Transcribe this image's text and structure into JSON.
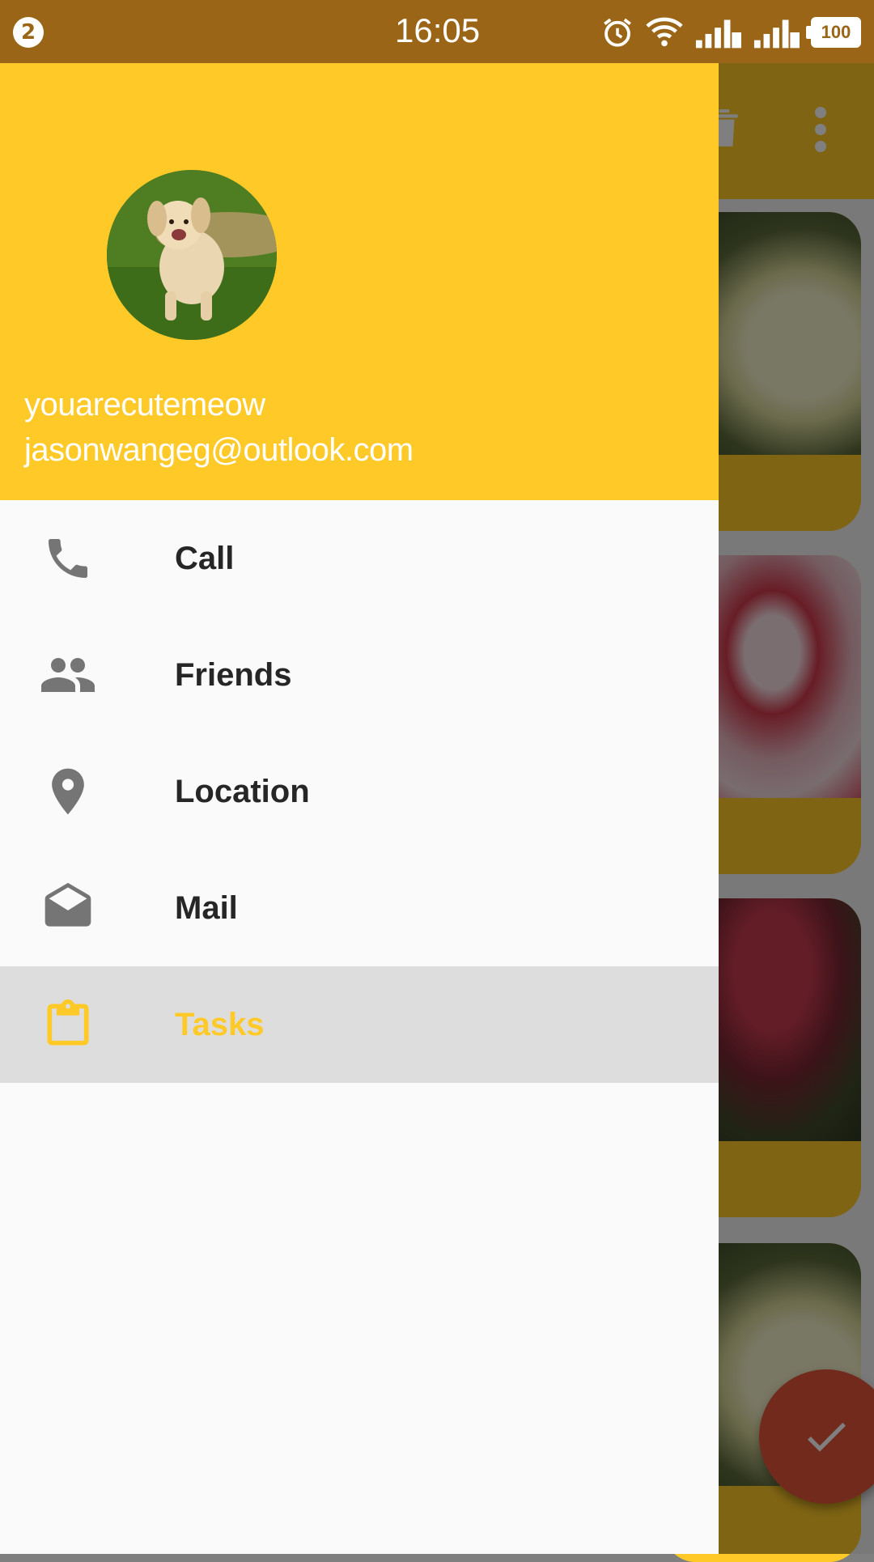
{
  "status_bar": {
    "notification_count": "2",
    "time": "16:05",
    "battery": "100",
    "icons": [
      "alarm-icon",
      "wifi-icon",
      "signal-sim2-icon",
      "signal-sim1-icon",
      "battery-icon"
    ]
  },
  "toolbar": {
    "icons": [
      "delete-icon",
      "more-vert-icon"
    ]
  },
  "drawer": {
    "header": {
      "username": "youarecutemeow",
      "email": "jasonwangeg@outlook.com"
    },
    "items": [
      {
        "label": "Call",
        "icon": "phone-icon",
        "active": false
      },
      {
        "label": "Friends",
        "icon": "people-icon",
        "active": false
      },
      {
        "label": "Location",
        "icon": "location-pin-icon",
        "active": false
      },
      {
        "label": "Mail",
        "icon": "mail-open-icon",
        "active": false
      },
      {
        "label": "Tasks",
        "icon": "clipboard-icon",
        "active": true
      }
    ]
  },
  "colors": {
    "primary": "#FFC928",
    "status_bar": "#9A6516",
    "active_item_bg": "#DDDDDD",
    "fab": "#E5553B",
    "icon_gray": "#757575"
  }
}
